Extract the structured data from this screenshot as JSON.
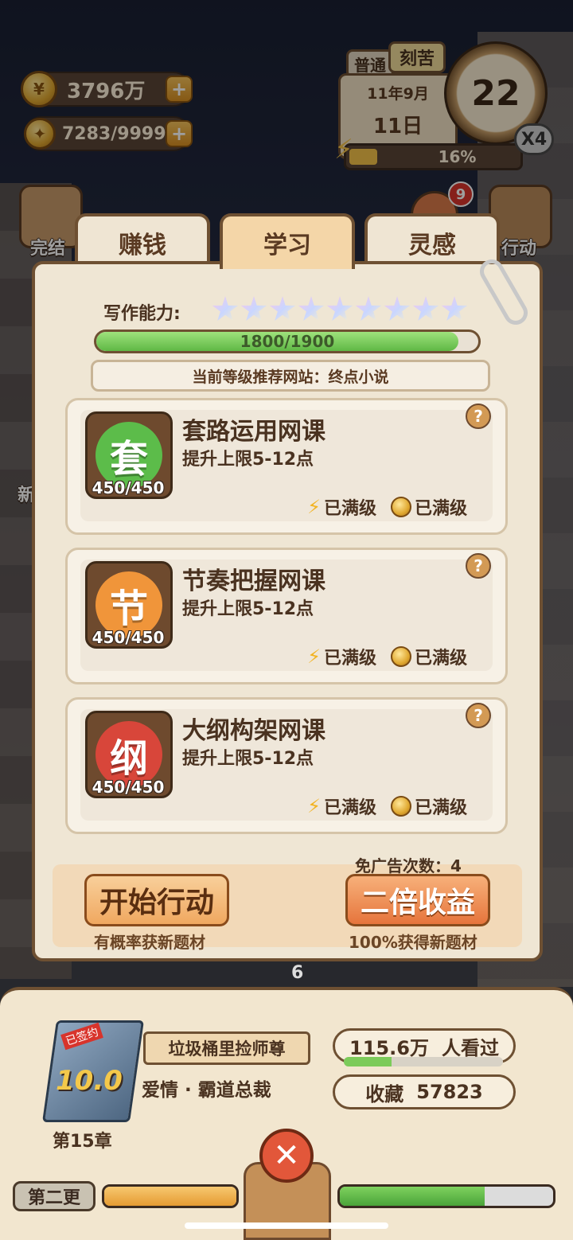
{
  "hud": {
    "coins": "3796万",
    "inspiration": "7283/9999",
    "difficulty_normal": "普通",
    "difficulty_hard": "刻苦",
    "date_month": "11年9月",
    "date_day": "11日",
    "clock_value": "22",
    "speed": "X4",
    "energy_percent": "16%",
    "energy_fraction": 0.16,
    "notification_count": "9"
  },
  "side_buttons": {
    "left_top": "完结",
    "right_top": "行动",
    "left_partial": "新"
  },
  "tabs": [
    {
      "label": "赚钱",
      "active": false
    },
    {
      "label": "学习",
      "active": true
    },
    {
      "label": "灵感",
      "active": false
    }
  ],
  "panel": {
    "skill_label": "写作能力:",
    "star_count": 9,
    "xp_text": "1800/1900",
    "xp_fraction": 0.9474,
    "recommend": "当前等级推荐网站：终点小说",
    "courses": [
      {
        "icon_char": "套",
        "icon_color": "#5cbc4a",
        "count": "450/450",
        "title": "套路运用网课",
        "desc": "提升上限5-12点",
        "energy_status": "已满级",
        "coin_status": "已满级",
        "help": "?"
      },
      {
        "icon_char": "节",
        "icon_color": "#f0953a",
        "count": "450/450",
        "title": "节奏把握网课",
        "desc": "提升上限5-12点",
        "energy_status": "已满级",
        "coin_status": "已满级",
        "help": "?"
      },
      {
        "icon_char": "纲",
        "icon_color": "#d8463a",
        "count": "450/450",
        "title": "大纲构架网课",
        "desc": "提升上限5-12点",
        "energy_status": "已满级",
        "coin_status": "已满级",
        "help": "?"
      }
    ],
    "free_ad": "免广告次数：4",
    "start_label": "开始行动",
    "start_sub": "有概率获新题材",
    "double_label": "二倍收益",
    "double_sub": "100%获得新题材"
  },
  "bottom": {
    "book_ribbon": "已签约",
    "book_score": "10.0",
    "chapter": "第15章",
    "novel_title": "垃圾桶里捡师尊",
    "genre": "爱情 · 霸道总裁",
    "views_value": "115.6万",
    "views_label": "人看过",
    "views_fraction": 0.3,
    "favorites_label": "收藏",
    "favorites_value": "57823",
    "update_label": "第二更",
    "left_progress_fraction": 1.0,
    "right_progress_fraction": 0.68,
    "bg_number": "6"
  }
}
